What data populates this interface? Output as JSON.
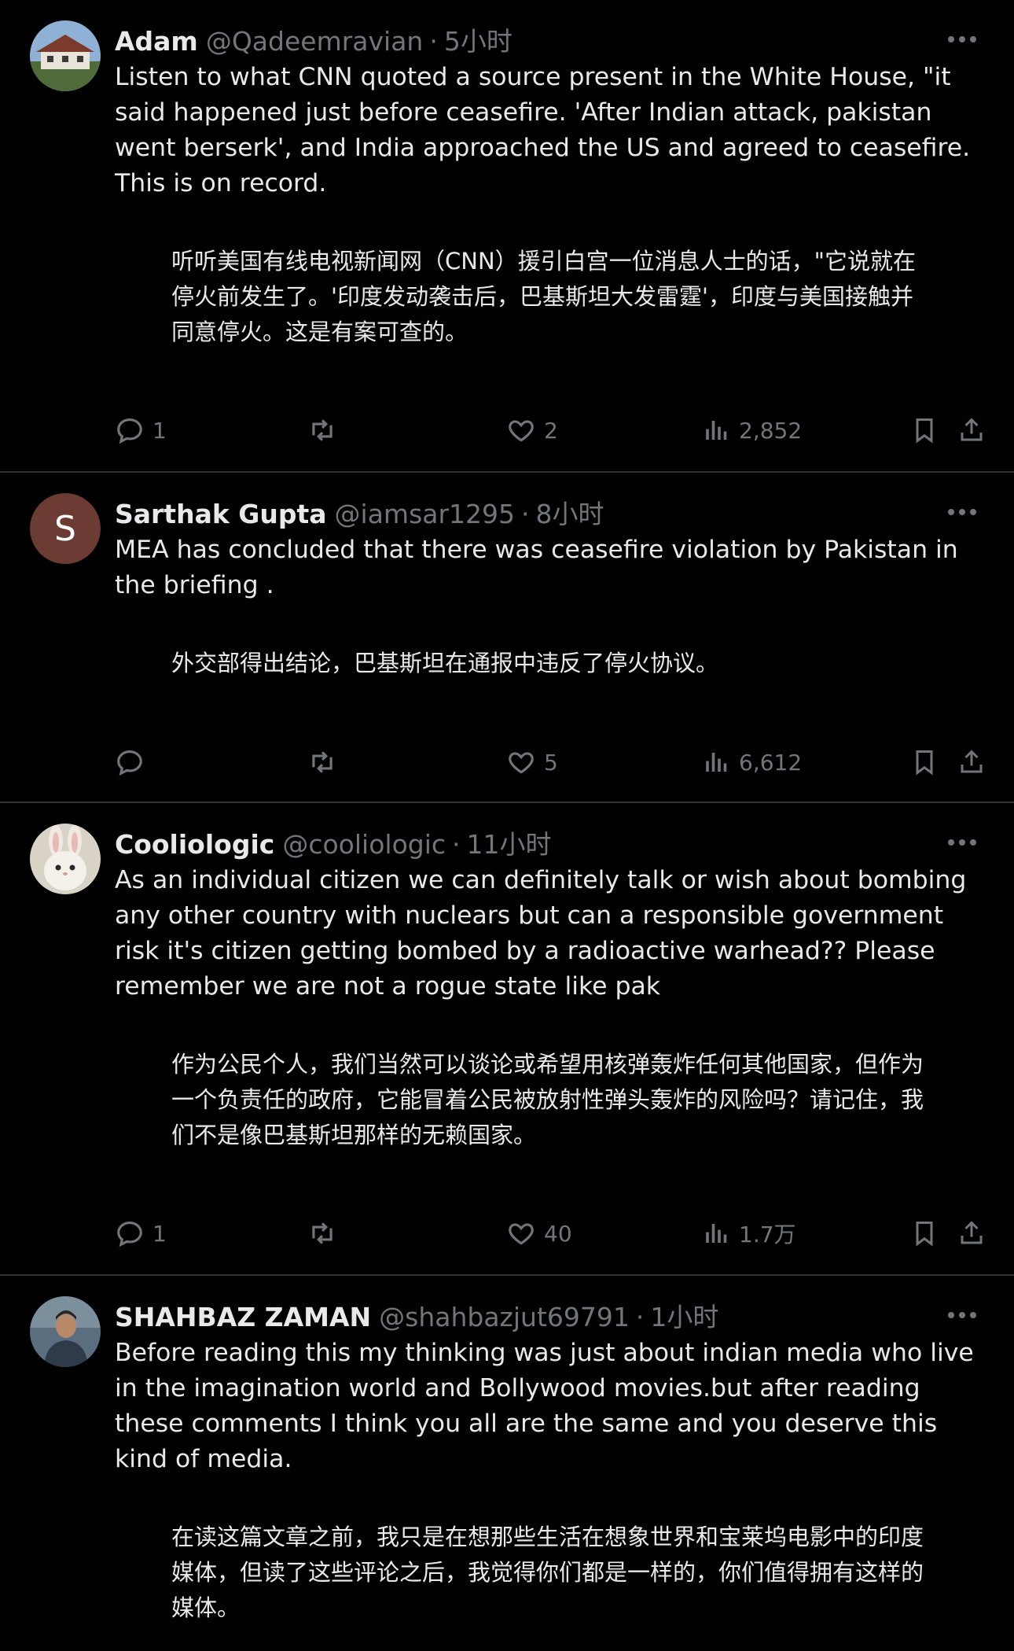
{
  "tweets": [
    {
      "name": "Adam",
      "handle": "@Qadeemravian",
      "dot": "·",
      "time": "5小时",
      "text": "Listen to what CNN quoted a source present in the White House, \"it said happened just before ceasefire. 'After Indian attack, pakistan went berserk', and India approached the US and agreed to ceasefire. This is on record.",
      "translation": "听听美国有线电视新闻网（CNN）援引白宫一位消息人士的话，\"它说就在停火前发生了。'印度发动袭击后，巴基斯坦大发雷霆'，印度与美国接触并同意停火。这是有案可查的。",
      "replies": "1",
      "retweets": "",
      "likes": "2",
      "views": "2,852"
    },
    {
      "name": "Sarthak Gupta",
      "handle": "@iamsar1295",
      "dot": "·",
      "time": "8小时",
      "avatar_letter": "S",
      "text": "MEA has concluded that there was ceasefire violation by Pakistan in the briefing .",
      "translation": "外交部得出结论，巴基斯坦在通报中违反了停火协议。",
      "replies": "",
      "retweets": "",
      "likes": "5",
      "views": "6,612"
    },
    {
      "name": "Cooliologic",
      "handle": "@cooliologic",
      "dot": "·",
      "time": "11小时",
      "text": "As an individual citizen we can definitely talk or wish about bombing any other country with nuclears but can a responsible government risk it's citizen getting bombed by a radioactive warhead?? Please remember we are not a rogue state like pak",
      "translation": "作为公民个人，我们当然可以谈论或希望用核弹轰炸任何其他国家，但作为一个负责任的政府，它能冒着公民被放射性弹头轰炸的风险吗？请记住，我们不是像巴基斯坦那样的无赖国家。",
      "replies": "1",
      "retweets": "",
      "likes": "40",
      "views": "1.7万"
    },
    {
      "name": "SHAHBAZ ZAMAN",
      "handle": "@shahbazjut69791",
      "dot": "·",
      "time": "1小时",
      "text": "Before reading this my thinking was just about indian media who live in the imagination world and Bollywood movies.but after reading these comments I think you all are the same and you deserve this kind of media.",
      "translation": "在读这篇文章之前，我只是在想那些生活在想象世界和宝莱坞电影中的印度媒体，但读了这些评论之后，我觉得你们都是一样的，你们值得拥有这样的媒体。"
    }
  ],
  "icons": {
    "reply": "reply-icon",
    "retweet": "retweet-icon",
    "like": "heart-icon",
    "views": "views-icon",
    "bookmark": "bookmark-icon",
    "share": "share-icon",
    "more": "more-icon"
  },
  "colors": {
    "background": "#000000",
    "text": "#e7e9ea",
    "muted": "#71767b",
    "divider": "#2f3336"
  }
}
